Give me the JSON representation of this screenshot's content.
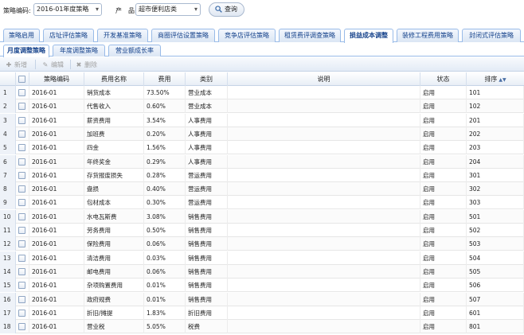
{
  "filters": {
    "code_label": "策略编码:",
    "code_value": "2016-01年度策略",
    "product_label": "产　品:",
    "product_value": "超市便利店类",
    "query_label": "查询"
  },
  "tabs_primary": [
    {
      "label": "策略启用"
    },
    {
      "label": "店址评估策略"
    },
    {
      "label": "开发基准策略"
    },
    {
      "label": "商圈评估设置策略"
    },
    {
      "label": "竞争店评估策略"
    },
    {
      "label": "租赁费评调查策略"
    },
    {
      "label": "损益成本调整"
    },
    {
      "label": "装修工程费用策略"
    },
    {
      "label": "封闭式评估策略"
    }
  ],
  "tabs_secondary": [
    {
      "label": "月度调整策略"
    },
    {
      "label": "年度调整策略"
    },
    {
      "label": "营业额成长率"
    }
  ],
  "toolbar": {
    "add_label": "新增",
    "edit_label": "编辑",
    "delete_label": "删除"
  },
  "columns": {
    "code": "策略编码",
    "name": "费用名称",
    "cost": "费用",
    "category": "类别",
    "description": "说明",
    "status": "状态",
    "order": "排序"
  },
  "rows": [
    {
      "num": "1",
      "code": "2016-01",
      "name": "销货成本",
      "cost": "73.50%",
      "category": "营业成本",
      "description": "",
      "status": "启用",
      "order": "101"
    },
    {
      "num": "2",
      "code": "2016-01",
      "name": "代售收入",
      "cost": "0.60%",
      "category": "营业成本",
      "description": "",
      "status": "启用",
      "order": "102"
    },
    {
      "num": "3",
      "code": "2016-01",
      "name": "薪资费用",
      "cost": "3.54%",
      "category": "人事费用",
      "description": "",
      "status": "启用",
      "order": "201"
    },
    {
      "num": "4",
      "code": "2016-01",
      "name": "加班费",
      "cost": "0.20%",
      "category": "人事费用",
      "description": "",
      "status": "启用",
      "order": "202"
    },
    {
      "num": "5",
      "code": "2016-01",
      "name": "四金",
      "cost": "1.56%",
      "category": "人事费用",
      "description": "",
      "status": "启用",
      "order": "203"
    },
    {
      "num": "6",
      "code": "2016-01",
      "name": "年终奖金",
      "cost": "0.29%",
      "category": "人事费用",
      "description": "",
      "status": "启用",
      "order": "204"
    },
    {
      "num": "7",
      "code": "2016-01",
      "name": "存货报废损失",
      "cost": "0.28%",
      "category": "营运费用",
      "description": "",
      "status": "启用",
      "order": "301"
    },
    {
      "num": "8",
      "code": "2016-01",
      "name": "盘损",
      "cost": "0.40%",
      "category": "营运费用",
      "description": "",
      "status": "启用",
      "order": "302"
    },
    {
      "num": "9",
      "code": "2016-01",
      "name": "包材成本",
      "cost": "0.30%",
      "category": "营运费用",
      "description": "",
      "status": "启用",
      "order": "303"
    },
    {
      "num": "10",
      "code": "2016-01",
      "name": "水电瓦斯费",
      "cost": "3.08%",
      "category": "销售费用",
      "description": "",
      "status": "启用",
      "order": "501"
    },
    {
      "num": "11",
      "code": "2016-01",
      "name": "劳务费用",
      "cost": "0.50%",
      "category": "销售费用",
      "description": "",
      "status": "启用",
      "order": "502"
    },
    {
      "num": "12",
      "code": "2016-01",
      "name": "保险费用",
      "cost": "0.06%",
      "category": "销售费用",
      "description": "",
      "status": "启用",
      "order": "503"
    },
    {
      "num": "13",
      "code": "2016-01",
      "name": "清洁费用",
      "cost": "0.03%",
      "category": "销售费用",
      "description": "",
      "status": "启用",
      "order": "504"
    },
    {
      "num": "14",
      "code": "2016-01",
      "name": "邮电费用",
      "cost": "0.06%",
      "category": "销售费用",
      "description": "",
      "status": "启用",
      "order": "505"
    },
    {
      "num": "15",
      "code": "2016-01",
      "name": "杂项购置费用",
      "cost": "0.01%",
      "category": "销售费用",
      "description": "",
      "status": "启用",
      "order": "506"
    },
    {
      "num": "16",
      "code": "2016-01",
      "name": "政府规费",
      "cost": "0.01%",
      "category": "销售费用",
      "description": "",
      "status": "启用",
      "order": "507"
    },
    {
      "num": "17",
      "code": "2016-01",
      "name": "折旧/摊提",
      "cost": "1.83%",
      "category": "折旧费用",
      "description": "",
      "status": "启用",
      "order": "601"
    },
    {
      "num": "18",
      "code": "2016-01",
      "name": "营业税",
      "cost": "5.05%",
      "category": "税费",
      "description": "",
      "status": "启用",
      "order": "801"
    }
  ]
}
